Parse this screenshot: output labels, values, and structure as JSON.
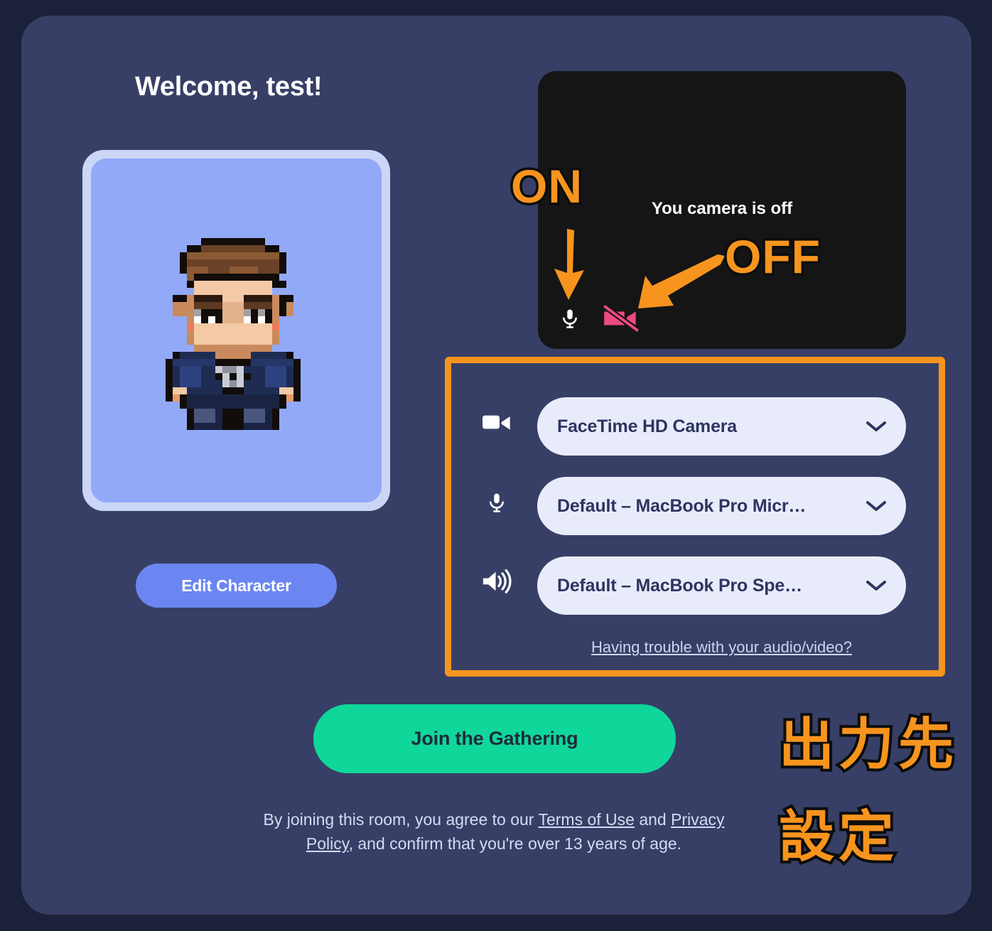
{
  "app": {
    "heading": "Welcome, test!"
  },
  "avatar": {
    "name": "character-avatar",
    "edit_button_label": "Edit Character"
  },
  "preview": {
    "status_text": "You camera is off",
    "mic_icon": "microphone-icon",
    "mic_state": "on",
    "camera_icon": "camera-off-icon",
    "camera_state": "off",
    "mic_color": "#ffffff",
    "camera_color": "#ef4a7f",
    "background": "#151515"
  },
  "annotations": {
    "on_label": "ON",
    "off_label": "OFF",
    "jp_line1": "出力先",
    "jp_line2": "設定",
    "accent_color": "#f7941e",
    "outline_color": "#0d0d0d"
  },
  "settings": {
    "border_color": "#f7941e",
    "devices": [
      {
        "icon": "video-camera-icon",
        "label": "FaceTime HD Camera",
        "chevron": "chevron-down-icon"
      },
      {
        "icon": "microphone-icon",
        "label": "Default – MacBook Pro Micr…",
        "chevron": "chevron-down-icon"
      },
      {
        "icon": "speaker-icon",
        "label": "Default – MacBook Pro Spe…",
        "chevron": "chevron-down-icon"
      }
    ],
    "trouble_link": "Having trouble with your audio/video?"
  },
  "join": {
    "button_label": "Join the Gathering",
    "button_color": "#0fd79a"
  },
  "terms": {
    "prefix": "By joining this room, you agree to our ",
    "terms_link": "Terms of Use",
    "middle": " and ",
    "privacy_link": "Privacy Policy",
    "suffix": ", and confirm that you're over 13 years of age."
  },
  "theme": {
    "page_background": "#1b2138",
    "panel_background": "#373f66",
    "avatar_frame": "#cbd6f7",
    "avatar_fill": "#92a9f8",
    "select_background": "#e8ecfa",
    "select_text": "#2d3561",
    "edit_button": "#6b86f0"
  }
}
